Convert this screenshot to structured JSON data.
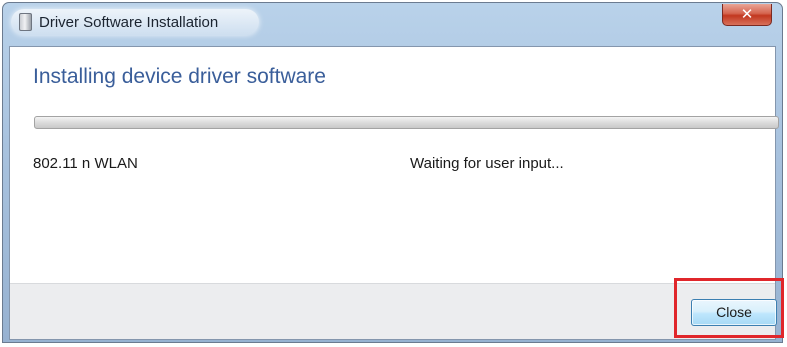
{
  "window": {
    "title": "Driver Software Installation",
    "close_glyph": "✕"
  },
  "main": {
    "heading": "Installing device driver software",
    "progress_fraction": 0.0,
    "device": {
      "name": "802.11 n WLAN",
      "status": "Waiting for user input..."
    }
  },
  "footer": {
    "close_label": "Close"
  },
  "colors": {
    "heading": "#3a5e9a",
    "highlight": "#e0262b",
    "close_x": "#c2371f"
  }
}
